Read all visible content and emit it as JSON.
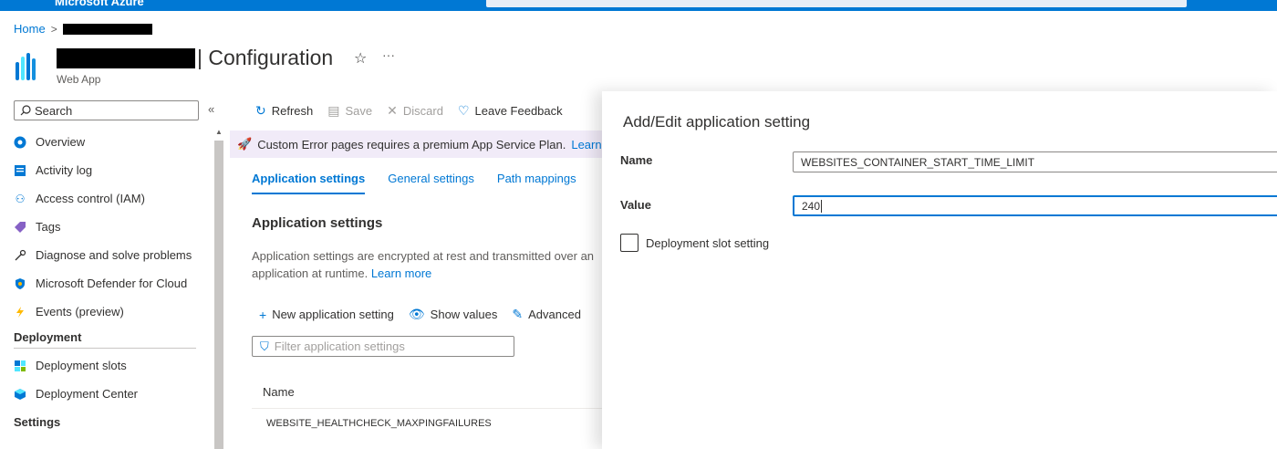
{
  "topbar": {
    "brand": "Microsoft Azure",
    "accent": "#0078d4"
  },
  "breadcrumb": {
    "home": "Home",
    "separator": ">"
  },
  "header": {
    "title": "| Configuration",
    "subtitle": "Web App",
    "favorite_icon": "star-icon",
    "more": "···"
  },
  "sidebar": {
    "search_placeholder": "Search",
    "collapse": "«",
    "items": [
      {
        "label": "Overview",
        "icon": "overview-icon"
      },
      {
        "label": "Activity log",
        "icon": "activity-log-icon"
      },
      {
        "label": "Access control (IAM)",
        "icon": "people-icon"
      },
      {
        "label": "Tags",
        "icon": "tag-icon"
      },
      {
        "label": "Diagnose and solve problems",
        "icon": "wrench-icon"
      },
      {
        "label": "Microsoft Defender for Cloud",
        "icon": "shield-icon"
      },
      {
        "label": "Events (preview)",
        "icon": "lightning-icon"
      }
    ],
    "deployment_section": "Deployment",
    "deployment_items": [
      {
        "label": "Deployment slots",
        "icon": "slots-icon"
      },
      {
        "label": "Deployment Center",
        "icon": "cube-icon"
      }
    ],
    "settings_section": "Settings"
  },
  "commands": {
    "refresh": "Refresh",
    "save": "Save",
    "discard": "Discard",
    "feedback": "Leave Feedback"
  },
  "banner": {
    "text": "Custom Error pages requires a premium App Service Plan.",
    "link": "Learn"
  },
  "tabs": {
    "app_settings": "Application settings",
    "general": "General settings",
    "path": "Path mappings"
  },
  "main": {
    "section_title": "Application settings",
    "description_line1": "Application settings are encrypted at rest and transmitted over an",
    "description_line2": "application at runtime.",
    "learn_more": "Learn more",
    "new_setting": "New application setting",
    "show_values": "Show values",
    "advanced": "Advanced",
    "filter_placeholder": "Filter application settings",
    "table_header_name": "Name",
    "rows": [
      "WEBSITE_HEALTHCHECK_MAXPINGFAILURES"
    ]
  },
  "panel": {
    "title": "Add/Edit application setting",
    "name_label": "Name",
    "name_value": "WEBSITES_CONTAINER_START_TIME_LIMIT",
    "value_label": "Value",
    "value_value": "240",
    "slot_setting": "Deployment slot setting"
  }
}
